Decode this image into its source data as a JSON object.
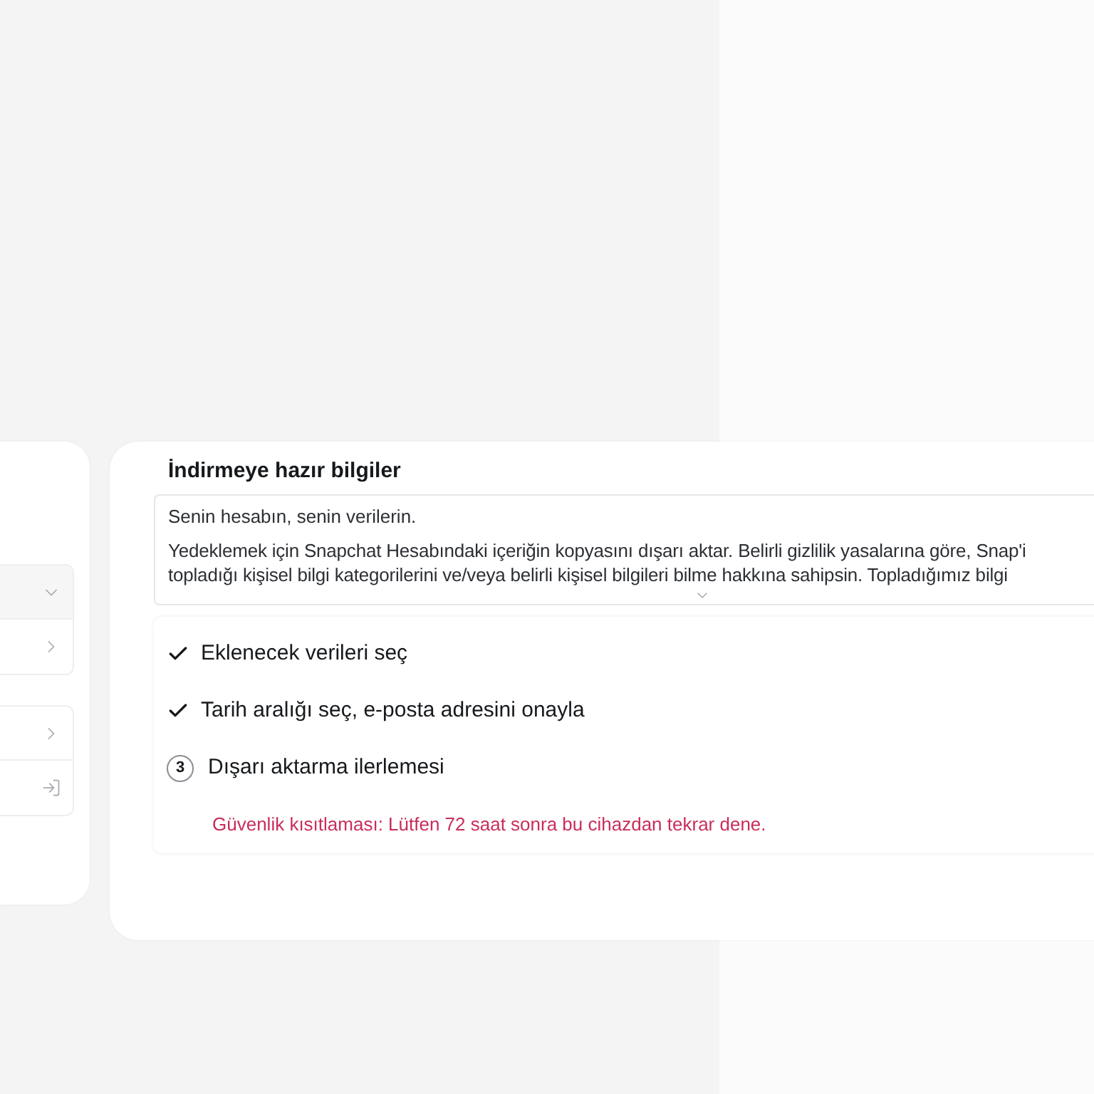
{
  "sidebar": {
    "groups": [
      {
        "rows": [
          {
            "kind": "dropdown"
          },
          {
            "kind": "link"
          }
        ]
      },
      {
        "rows": [
          {
            "kind": "link"
          },
          {
            "kind": "logout"
          }
        ]
      }
    ]
  },
  "main": {
    "title": "İndirmeye hazır bilgiler",
    "info_box": {
      "heading": "Senin hesabın, senin verilerin.",
      "paragraph_lines": [
        "Yedeklemek için Snapchat Hesabındaki içeriğin kopyasını dışarı aktar. Belirli gizlilik yasalarına göre, Snap'i",
        "topladığı kişisel bilgi kategorilerini ve/veya belirli kişisel bilgileri bilme hakkına sahipsin. Topladığımız bilgi"
      ]
    },
    "steps": [
      {
        "kind": "done",
        "label": "Eklenecek verileri seç"
      },
      {
        "kind": "done",
        "label": "Tarih aralığı seç, e-posta adresini onayla"
      },
      {
        "kind": "current",
        "number": "3",
        "label": "Dışarı aktarma ilerlemesi"
      }
    ],
    "error": "Güvenlik kısıtlaması: Lütfen 72 saat sonra bu cihazdan tekrar dene."
  }
}
